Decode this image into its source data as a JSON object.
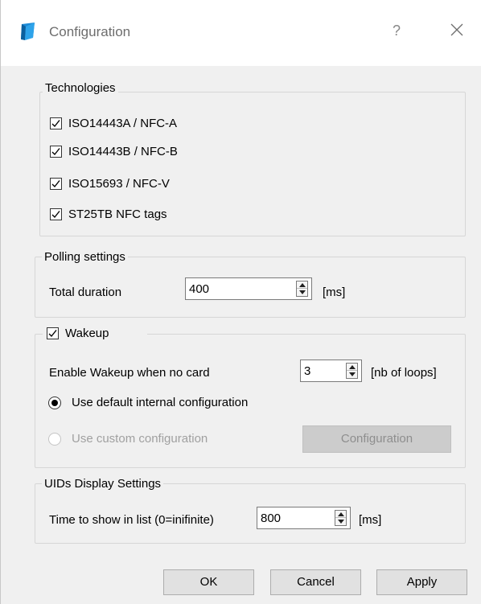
{
  "window": {
    "title": "Configuration",
    "help_label": "?",
    "icon": "app-icon"
  },
  "technologies": {
    "legend": "Technologies",
    "items": [
      {
        "label": "ISO14443A / NFC-A",
        "checked": true
      },
      {
        "label": "ISO14443B / NFC-B",
        "checked": true
      },
      {
        "label": "ISO15693 / NFC-V",
        "checked": true
      },
      {
        "label": "ST25TB NFC tags",
        "checked": true
      }
    ]
  },
  "polling": {
    "legend": "Polling settings",
    "duration_label": "Total duration",
    "duration_value": "400",
    "unit": "[ms]"
  },
  "wakeup": {
    "legend": "Wakeup",
    "checked": true,
    "enable_label": "Enable Wakeup when no card",
    "loops_value": "3",
    "loops_unit": "[nb of loops]",
    "default_option": "Use default internal configuration",
    "custom_option": "Use custom configuration",
    "configuration_button": "Configuration"
  },
  "uids": {
    "legend": "UIDs Display Settings",
    "time_label": "Time to show in list (0=inifinite)",
    "time_value": "800",
    "unit": "[ms]"
  },
  "footer": {
    "ok": "OK",
    "cancel": "Cancel",
    "apply": "Apply"
  },
  "colors": {
    "accent": "#1c8ad6",
    "dialog_bg": "#f0f0f0",
    "disabled_text": "#a0a0a0"
  }
}
